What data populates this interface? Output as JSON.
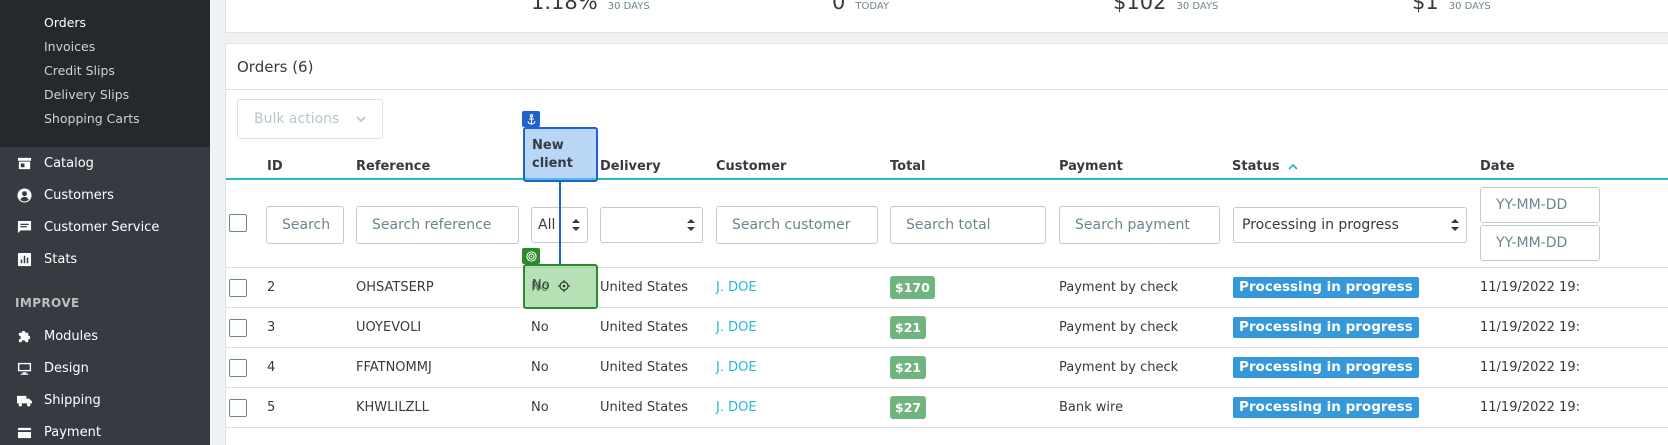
{
  "sidebar": {
    "sub_items": [
      "Orders",
      "Invoices",
      "Credit Slips",
      "Delivery Slips",
      "Shopping Carts"
    ],
    "nav_items": [
      {
        "label": "Catalog",
        "icon": "store-icon"
      },
      {
        "label": "Customers",
        "icon": "account-circle-icon"
      },
      {
        "label": "Customer Service",
        "icon": "chat-icon"
      },
      {
        "label": "Stats",
        "icon": "bar-chart-icon"
      }
    ],
    "section_label": "IMPROVE",
    "improve_items": [
      {
        "label": "Modules",
        "icon": "puzzle-icon"
      },
      {
        "label": "Design",
        "icon": "desktop-icon"
      },
      {
        "label": "Shipping",
        "icon": "truck-icon"
      },
      {
        "label": "Payment",
        "icon": "card-icon"
      }
    ]
  },
  "kpis": [
    {
      "value": "1.18%",
      "label": "30 DAYS"
    },
    {
      "value": "0",
      "label": "TODAY"
    },
    {
      "value": "$102",
      "label": "30 DAYS"
    },
    {
      "value": "$1",
      "label": "30 DAYS"
    }
  ],
  "orders": {
    "title": "Orders (6)",
    "bulk_actions": "Bulk actions",
    "columns": {
      "id": "ID",
      "reference": "Reference",
      "new_client_1": "New",
      "new_client_2": "client",
      "delivery": "Delivery",
      "customer": "Customer",
      "total": "Total",
      "payment": "Payment",
      "status": "Status",
      "date": "Date"
    },
    "filters": {
      "id_placeholder": "Search",
      "reference_placeholder": "Search reference",
      "new_client_value": "All",
      "delivery_value": "",
      "customer_placeholder": "Search customer",
      "total_placeholder": "Search total",
      "payment_placeholder": "Search payment",
      "status_value": "Processing in progress",
      "date_from_placeholder": "YY-MM-DD",
      "date_to_placeholder": "YY-MM-DD"
    },
    "rows": [
      {
        "id": "2",
        "reference": "OHSATSERP",
        "new_client": "No",
        "delivery": "United States",
        "customer": "J. DOE",
        "total": "$170",
        "payment": "Payment by check",
        "status": "Processing in progress",
        "date": "11/19/2022 19:"
      },
      {
        "id": "3",
        "reference": "UOYEVOLI",
        "new_client": "No",
        "delivery": "United States",
        "customer": "J. DOE",
        "total": "$21",
        "payment": "Payment by check",
        "status": "Processing in progress",
        "date": "11/19/2022 19:"
      },
      {
        "id": "4",
        "reference": "FFATNOMMJ",
        "new_client": "No",
        "delivery": "United States",
        "customer": "J. DOE",
        "total": "$21",
        "payment": "Payment by check",
        "status": "Processing in progress",
        "date": "11/19/2022 19:"
      },
      {
        "id": "5",
        "reference": "KHWLILZLL",
        "new_client": "No",
        "delivery": "United States",
        "customer": "J. DOE",
        "total": "$27",
        "payment": "Bank wire",
        "status": "Processing in progress",
        "date": "11/19/2022 19:"
      }
    ]
  },
  "colors": {
    "sidebar_bg": "#363a41",
    "sidebar_sub_bg": "#25292e",
    "accent": "#25b9d7",
    "total_badge": "#70b580",
    "status_badge": "#3498db",
    "anchor": "#1e64c8",
    "target": "#2b8a2b"
  }
}
